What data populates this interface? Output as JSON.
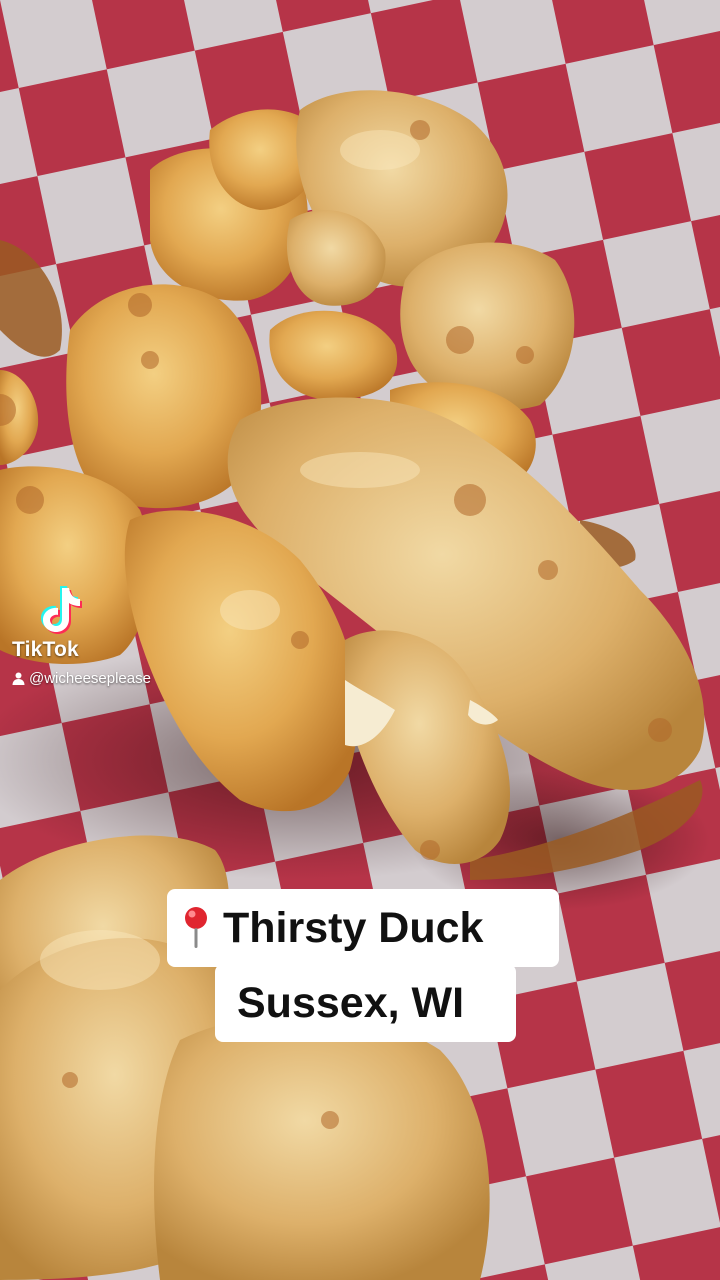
{
  "watermark": {
    "brand": "TikTok",
    "handle": "@wicheeseplease",
    "logo_icon": "tiktok-logo-icon",
    "user_icon": "person-icon"
  },
  "caption": {
    "icon": "red-pushpin-icon",
    "line1": "Thirsty Duck",
    "line2": "Sussex, WI"
  },
  "colors": {
    "checker_red": "#c8394e",
    "checker_white": "#e9e6e8",
    "caption_bg": "#ffffff",
    "caption_text": "#111111"
  }
}
